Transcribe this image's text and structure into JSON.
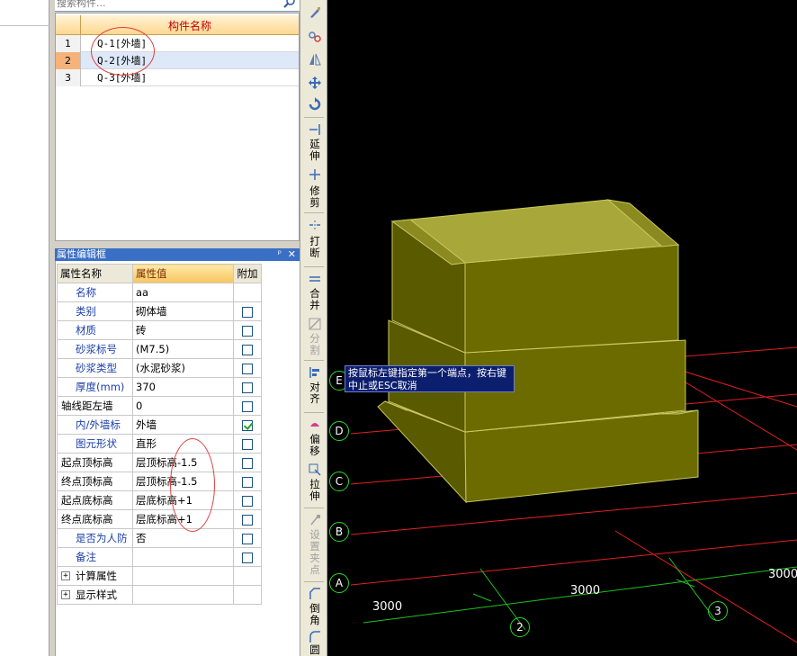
{
  "search": {
    "placeholder": "搜索构件..."
  },
  "components": {
    "header": "构件名称",
    "rows": [
      {
        "num": "1",
        "name": "Q-1[外墙]",
        "selected": false
      },
      {
        "num": "2",
        "name": "Q-2[外墙]",
        "selected": true
      },
      {
        "num": "3",
        "name": "Q-3[外墙]",
        "selected": false
      }
    ]
  },
  "properties": {
    "title": "属性编辑框",
    "pin": "ᵖ",
    "close": "✕",
    "columns": {
      "name": "属性名称",
      "value": "属性值",
      "extra": "附加"
    },
    "rows": [
      {
        "name": "名称",
        "value": "aa",
        "checkbox": null
      },
      {
        "name": "类别",
        "value": "砌体墙",
        "checkbox": false
      },
      {
        "name": "材质",
        "value": "砖",
        "checkbox": false
      },
      {
        "name": "砂浆标号",
        "value": "(M7.5)",
        "checkbox": false
      },
      {
        "name": "砂浆类型",
        "value": "(水泥砂浆)",
        "checkbox": false
      },
      {
        "name": "厚度(mm)",
        "value": "370",
        "checkbox": false
      },
      {
        "name": "轴线距左墙",
        "value": "0",
        "checkbox": false
      },
      {
        "name": "内/外墙标",
        "value": "外墙",
        "checkbox": true
      },
      {
        "name": "图元形状",
        "value": "直形",
        "checkbox": false
      },
      {
        "name": "起点顶标高",
        "value": "层顶标高-1.5",
        "checkbox": false
      },
      {
        "name": "终点顶标高",
        "value": "层顶标高-1.5",
        "checkbox": false
      },
      {
        "name": "起点底标高",
        "value": "层底标高+1",
        "checkbox": false
      },
      {
        "name": "终点底标高",
        "value": "层底标高+1",
        "checkbox": false
      },
      {
        "name": "是否为人防",
        "value": "否",
        "checkbox": false
      },
      {
        "name": "备注",
        "value": "",
        "checkbox": false
      }
    ],
    "groups": [
      {
        "name": "计算属性"
      },
      {
        "name": "显示样式"
      }
    ]
  },
  "toolbar": {
    "extend": "延伸",
    "trim": "修剪",
    "break": "打断",
    "merge": "合并",
    "split": "分割",
    "align": "对齐",
    "offset": "偏移",
    "stretch": "拉伸",
    "set_clamp": "设置夹点",
    "chamfer": "倒角",
    "fillet": "圆"
  },
  "viewport": {
    "tooltip": "按鼠标左键指定第一个端点，按右键中止或ESC取消",
    "axes_letters": [
      "E",
      "D",
      "C",
      "B",
      "A"
    ],
    "axes_numbers": [
      "2",
      "3"
    ],
    "dimensions": [
      "3000",
      "3000",
      "3000"
    ],
    "colors": {
      "wall_face": "#6b6b00",
      "wall_top": "#a8a83a",
      "grid_red": "#e02020",
      "grid_green": "#20c020"
    }
  }
}
